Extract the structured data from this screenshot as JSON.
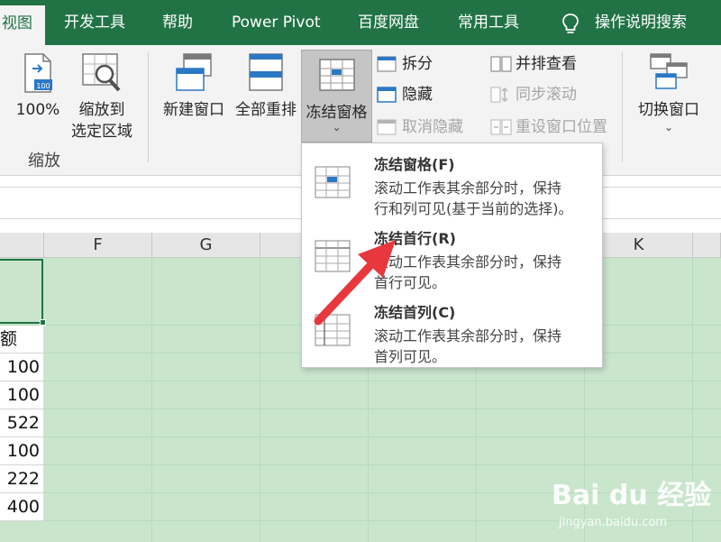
{
  "tabs": [
    {
      "label": "视图",
      "active": true
    },
    {
      "label": "开发工具"
    },
    {
      "label": "帮助"
    },
    {
      "label": "Power Pivot"
    },
    {
      "label": "百度网盘"
    },
    {
      "label": "常用工具"
    }
  ],
  "tell_me": "操作说明搜索",
  "ribbon": {
    "zoom_group_label": "缩放",
    "zoom100": "100%",
    "zoom_to_selection_line1": "缩放到",
    "zoom_to_selection_line2": "选定区域",
    "new_window": "新建窗口",
    "arrange_all": "全部重排",
    "freeze_panes": "冻结窗格",
    "split": "拆分",
    "hide": "隐藏",
    "unhide": "取消隐藏",
    "side_by_side": "并排查看",
    "sync_scroll": "同步滚动",
    "reset_position": "重设窗口位置",
    "switch_windows": "切换窗口"
  },
  "columns": [
    "F",
    "G",
    "K"
  ],
  "cells": [
    "额",
    "100",
    "100",
    "522",
    "100",
    "222",
    "400"
  ],
  "menu": {
    "items": [
      {
        "title": "冻结窗格(F)",
        "desc1": "滚动工作表其余部分时，保持",
        "desc2": "行和列可见(基于当前的选择)。"
      },
      {
        "title": "冻结首行(R)",
        "desc1": "滚动工作表其余部分时，保持",
        "desc2": "首行可见。"
      },
      {
        "title": "冻结首列(C)",
        "desc1": "滚动工作表其余部分时，保持",
        "desc2": "首列可见。"
      }
    ]
  },
  "watermark": {
    "text": "Bai du 经验",
    "sub": "jingyan.baidu.com"
  },
  "colors": {
    "accent": "#217346",
    "grid": "#c9e6cd",
    "arrow": "#e8383d"
  }
}
